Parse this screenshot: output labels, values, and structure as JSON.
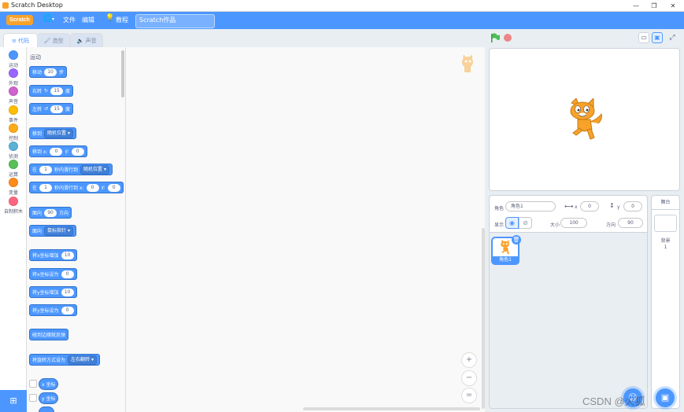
{
  "window": {
    "title": "Scratch Desktop",
    "controls": [
      "—",
      "❐",
      "✕"
    ]
  },
  "menubar": {
    "logo": "Scratch",
    "file": "文件",
    "edit": "编辑",
    "tutorials": "教程",
    "project_title": "Scratch作品"
  },
  "tabs": {
    "code": "代码",
    "costumes": "造型",
    "sounds": "声音"
  },
  "categories": [
    {
      "label": "运动",
      "color": "#4c97ff"
    },
    {
      "label": "外观",
      "color": "#9966ff"
    },
    {
      "label": "声音",
      "color": "#cf63cf"
    },
    {
      "label": "事件",
      "color": "#ffbf00"
    },
    {
      "label": "控制",
      "color": "#ffab19"
    },
    {
      "label": "侦测",
      "color": "#5cb1d6"
    },
    {
      "label": "运算",
      "color": "#59c059"
    },
    {
      "label": "变量",
      "color": "#ff8c1a"
    },
    {
      "label": "自制积木",
      "color": "#ff6680"
    }
  ],
  "palette": {
    "section": "运动",
    "blocks": {
      "move": [
        "移动",
        "10",
        "步"
      ],
      "turn_right": [
        "右转",
        "15",
        "度"
      ],
      "turn_left": [
        "左转",
        "15",
        "度"
      ],
      "goto": [
        "移到",
        "随机位置"
      ],
      "goto_xy": [
        "移到 x:",
        "0",
        "y:",
        "0"
      ],
      "glide": [
        "在",
        "1",
        "秒内滑行到",
        "随机位置"
      ],
      "glide_xy": [
        "在",
        "1",
        "秒内滑行到 x:",
        "0",
        "y:",
        "0"
      ],
      "point": [
        "面向",
        "90",
        "方向"
      ],
      "point_towards": [
        "面向",
        "鼠标指针"
      ],
      "change_x": [
        "将x坐标增加",
        "10"
      ],
      "set_x": [
        "将x坐标设为",
        "0"
      ],
      "change_y": [
        "将y坐标增加",
        "10"
      ],
      "set_y": [
        "将y坐标设为",
        "0"
      ],
      "bounce": [
        "碰到边缘就反弹"
      ],
      "rotation": [
        "将旋转方式设为",
        "左右翻转"
      ],
      "xpos": "x 坐标",
      "ypos": "y 坐标"
    }
  },
  "zoom": {
    "in": "+",
    "out": "−",
    "reset": "="
  },
  "sprite_info": {
    "sprite_label": "角色",
    "sprite_name": "角色1",
    "x_label": "x",
    "x_value": "0",
    "y_label": "y",
    "y_value": "0",
    "show_label": "显示",
    "size_label": "大小",
    "size_value": "100",
    "direction_label": "方向",
    "direction_value": "90"
  },
  "sprite_list": [
    {
      "name": "角色1",
      "selected": true
    }
  ],
  "stage_pane": {
    "title": "舞台",
    "backdrops_label": "背景",
    "backdrops_count": "1"
  },
  "watermark": "CSDN @火狐"
}
